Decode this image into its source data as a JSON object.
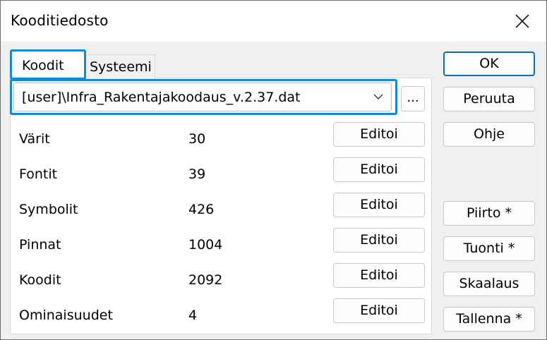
{
  "window": {
    "title": "Kooditiedosto",
    "close_icon": "close-icon"
  },
  "tabs": [
    {
      "label": "Koodit",
      "selected": true
    },
    {
      "label": "Systeemi",
      "selected": false
    }
  ],
  "file": {
    "value": "[user]\\Infra_Rakentajakoodaus_v.2.37.dat",
    "browse_label": "..."
  },
  "rows": [
    {
      "label": "Värit",
      "count": "30",
      "button": "Editoi"
    },
    {
      "label": "Fontit",
      "count": "39",
      "button": "Editoi"
    },
    {
      "label": "Symbolit",
      "count": "426",
      "button": "Editoi"
    },
    {
      "label": "Pinnat",
      "count": "1004",
      "button": "Editoi"
    },
    {
      "label": "Koodit",
      "count": "2092",
      "button": "Editoi"
    },
    {
      "label": "Ominaisuudet",
      "count": "4",
      "button": "Editoi"
    }
  ],
  "side_buttons": {
    "ok": "OK",
    "cancel": "Peruuta",
    "help": "Ohje",
    "draw": "Piirto *",
    "import": "Tuonti *",
    "scale": "Skaalaus",
    "save": "Tallenna *"
  },
  "colors": {
    "focus_highlight": "#0f8ad6",
    "default_button_border": "#0f6cc0",
    "dialog_background": "#f0f0f0"
  }
}
